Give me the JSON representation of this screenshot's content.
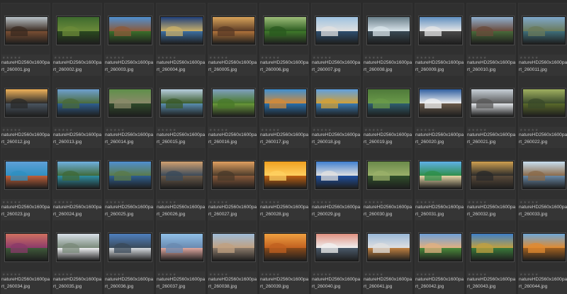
{
  "thumbnails": [
    {
      "name": "natureHD2560x1600part_260001.jpg",
      "stars": "★★★★★",
      "sky": "#b9c3c9",
      "land": "#7a4e33",
      "feature": "#3a2a20"
    },
    {
      "name": "natureHD2560x1600part_260002.jpg",
      "stars": "★★★★★",
      "sky": "#3e6a2e",
      "land": "#2b4a1f",
      "feature": "#6c8b3a"
    },
    {
      "name": "natureHD2560x1600part_260003.jpg",
      "stars": "★★★★★",
      "sky": "#4f8fd0",
      "land": "#3b6f2a",
      "feature": "#8c5a3a"
    },
    {
      "name": "natureHD2560x1600part_260004.jpg",
      "stars": "★★★★★",
      "sky": "#1f3f7a",
      "land": "#3d6fa0",
      "feature": "#c9b06a"
    },
    {
      "name": "natureHD2560x1600part_260005.jpg",
      "stars": "★★★★★",
      "sky": "#d9a45a",
      "land": "#b0733a",
      "feature": "#5a3a25"
    },
    {
      "name": "natureHD2560x1600part_260006.jpg",
      "stars": "★★★★★",
      "sky": "#9fbf7a",
      "land": "#3f7a2a",
      "feature": "#2a5a1f"
    },
    {
      "name": "natureHD2560x1600part_260007.jpg",
      "stars": "★★★★★",
      "sky": "#9ec2e0",
      "land": "#2f4f6f",
      "feature": "#e0e0e0"
    },
    {
      "name": "natureHD2560x1600part_260008.jpg",
      "stars": "★★★★★",
      "sky": "#6a7f8a",
      "land": "#3a4a55",
      "feature": "#d8e4ea"
    },
    {
      "name": "natureHD2560x1600part_260009.jpg",
      "stars": "★★★★★",
      "sky": "#5f8fc0",
      "land": "#4a4a4a",
      "feature": "#e6e6e6"
    },
    {
      "name": "natureHD2560x1600part_260010.jpg",
      "stars": "★★★★★",
      "sky": "#8fb0d0",
      "land": "#4a6a3a",
      "feature": "#6a4a3a"
    },
    {
      "name": "natureHD2560x1600part_260011.jpg",
      "stars": "★★★★★",
      "sky": "#7fa8cc",
      "land": "#3f6f7a",
      "feature": "#6a7a5a"
    },
    {
      "name": "natureHD2560x1600part_260012.jpg",
      "stars": "★★★★★",
      "sky": "#f0b25a",
      "land": "#4a5560",
      "feature": "#2a2a2a"
    },
    {
      "name": "natureHD2560x1600part_260013.jpg",
      "stars": "★★★★★",
      "sky": "#6fa0d0",
      "land": "#2f5f8f",
      "feature": "#4a6a3a"
    },
    {
      "name": "natureHD2560x1600part_260014.jpg",
      "stars": "★★★★★",
      "sky": "#5f8f4a",
      "land": "#2f4a2a",
      "feature": "#8a8a6a"
    },
    {
      "name": "natureHD2560x1600part_260015.jpg",
      "stars": "★★★★★",
      "sky": "#b8cfe0",
      "land": "#5a8fb0",
      "feature": "#3a5a2a"
    },
    {
      "name": "natureHD2560x1600part_260016.jpg",
      "stars": "★★★★★",
      "sky": "#7fa0c0",
      "land": "#6a9a3a",
      "feature": "#4a7a2a"
    },
    {
      "name": "natureHD2560x1600part_260017.jpg",
      "stars": "★★★★★",
      "sky": "#3f8fd0",
      "land": "#2a6faa",
      "feature": "#d08a3a"
    },
    {
      "name": "natureHD2560x1600part_260018.jpg",
      "stars": "★★★★★",
      "sky": "#5fa0e0",
      "land": "#3a7ab0",
      "feature": "#d0a03a"
    },
    {
      "name": "natureHD2560x1600part_260019.jpg",
      "stars": "★★★★★",
      "sky": "#4f7a3a",
      "land": "#2f5f6f",
      "feature": "#6a9a4a"
    },
    {
      "name": "natureHD2560x1600part_260020.jpg",
      "stars": "★★★★★",
      "sky": "#2f5fa0",
      "land": "#6a5a4a",
      "feature": "#f0f0f0"
    },
    {
      "name": "natureHD2560x1600part_260021.jpg",
      "stars": "★★★★★",
      "sky": "#c8d0d8",
      "land": "#e4e8ec",
      "feature": "#5a5a5a"
    },
    {
      "name": "natureHD2560x1600part_260022.jpg",
      "stars": "★★★★★",
      "sky": "#a0b060",
      "land": "#5a6a2a",
      "feature": "#3a4a2a"
    },
    {
      "name": "natureHD2560x1600part_260023.jpg",
      "stars": "★★★★★",
      "sky": "#5fa0d8",
      "land": "#c0603a",
      "feature": "#2f8fc0"
    },
    {
      "name": "natureHD2560x1600part_260024.jpg",
      "stars": "★★★★★",
      "sky": "#6fb0e0",
      "land": "#2f8fa0",
      "feature": "#3f6a3a"
    },
    {
      "name": "natureHD2560x1600part_260025.jpg",
      "stars": "★★★★★",
      "sky": "#4f8fd0",
      "land": "#2f5f8f",
      "feature": "#5a7a4a"
    },
    {
      "name": "natureHD2560x1600part_260026.jpg",
      "stars": "★★★★★",
      "sky": "#d0a070",
      "land": "#6a5a4a",
      "feature": "#3a4a5a"
    },
    {
      "name": "natureHD2560x1600part_260027.jpg",
      "stars": "★★★★★",
      "sky": "#e0a060",
      "land": "#8a5a3a",
      "feature": "#4a3a2a"
    },
    {
      "name": "natureHD2560x1600part_260028.jpg",
      "stars": "★★★★★",
      "sky": "#f0a020",
      "land": "#c06010",
      "feature": "#ffd060"
    },
    {
      "name": "natureHD2560x1600part_260029.jpg",
      "stars": "★★★★★",
      "sky": "#3f7fd0",
      "land": "#1f4f9f",
      "feature": "#e0e0e0"
    },
    {
      "name": "natureHD2560x1600part_260030.jpg",
      "stars": "★★★★★",
      "sky": "#6a8a4a",
      "land": "#2f4f2a",
      "feature": "#9ab06a"
    },
    {
      "name": "natureHD2560x1600part_260031.jpg",
      "stars": "★★★★★",
      "sky": "#5fb0e8",
      "land": "#e8d8a8",
      "feature": "#2f8f4a"
    },
    {
      "name": "natureHD2560x1600part_260032.jpg",
      "stars": "★★★★★",
      "sky": "#d0a050",
      "land": "#5a4a3a",
      "feature": "#2a2a2a"
    },
    {
      "name": "natureHD2560x1600part_260033.jpg",
      "stars": "★★★★★",
      "sky": "#c8dff0",
      "land": "#6a8aa8",
      "feature": "#8a6a4a"
    },
    {
      "name": "natureHD2560x1600part_260034.jpg",
      "stars": "★★★★★",
      "sky": "#d07060",
      "land": "#3f5a3a",
      "feature": "#8a3a6a"
    },
    {
      "name": "natureHD2560x1600part_260035.jpg",
      "stars": "★★★★★",
      "sky": "#d8e0e8",
      "land": "#f0f2f4",
      "feature": "#7a8a7a"
    },
    {
      "name": "natureHD2560x1600part_260036.jpg",
      "stars": "★★★★★",
      "sky": "#4f80c0",
      "land": "#d8dde2",
      "feature": "#3a4a5a"
    },
    {
      "name": "natureHD2560x1600part_260037.jpg",
      "stars": "★★★★★",
      "sky": "#90c0e8",
      "land": "#e0a8a0",
      "feature": "#6a8ab0"
    },
    {
      "name": "natureHD2560x1600part_260038.jpg",
      "stars": "★★★★★",
      "sky": "#9fbcd8",
      "land": "#8a7a6a",
      "feature": "#c0a080"
    },
    {
      "name": "natureHD2560x1600part_260039.jpg",
      "stars": "★★★★★",
      "sky": "#f0a040",
      "land": "#8a4a1a",
      "feature": "#c06020"
    },
    {
      "name": "natureHD2560x1600part_260040.jpg",
      "stars": "★★★★★",
      "sky": "#e09080",
      "land": "#4a5a6a",
      "feature": "#f0f0f0"
    },
    {
      "name": "natureHD2560x1600part_260041.jpg",
      "stars": "★★★★★",
      "sky": "#9ab8d8",
      "land": "#c08040",
      "feature": "#e0e0e0"
    },
    {
      "name": "natureHD2560x1600part_260042.jpg",
      "stars": "★★★★★",
      "sky": "#6fa0d8",
      "land": "#4a8a3a",
      "feature": "#e0b080"
    },
    {
      "name": "natureHD2560x1600part_260043.jpg",
      "stars": "★★★★★",
      "sky": "#3f80c8",
      "land": "#3a7a3a",
      "feature": "#c0a040"
    },
    {
      "name": "natureHD2560x1600part_260044.jpg",
      "stars": "★★★★★",
      "sky": "#6fa8d8",
      "land": "#a06020",
      "feature": "#e08a30"
    }
  ]
}
